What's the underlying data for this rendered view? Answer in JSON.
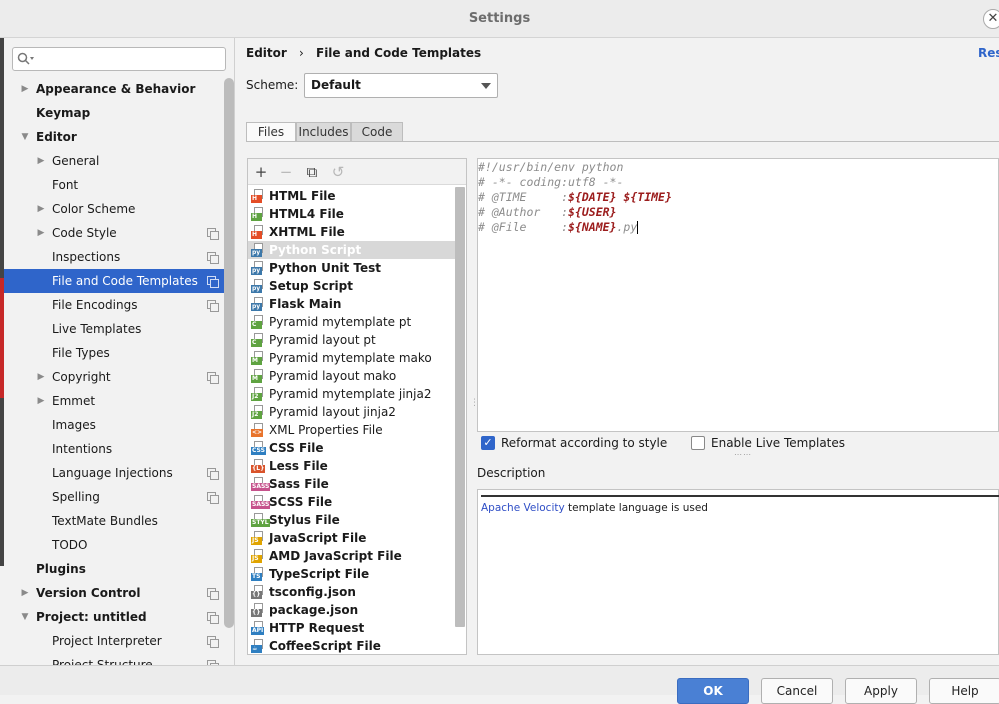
{
  "window": {
    "title": "Settings"
  },
  "search": {
    "placeholder": ""
  },
  "sidebar": {
    "items": [
      {
        "label": "Appearance & Behavior",
        "level": 0,
        "bold": true,
        "arrow": "collapsed",
        "copy": false
      },
      {
        "label": "Keymap",
        "level": 0,
        "bold": true,
        "arrow": "none",
        "copy": false
      },
      {
        "label": "Editor",
        "level": 0,
        "bold": true,
        "arrow": "expanded",
        "copy": false
      },
      {
        "label": "General",
        "level": 1,
        "bold": false,
        "arrow": "collapsed",
        "copy": false
      },
      {
        "label": "Font",
        "level": 1,
        "bold": false,
        "arrow": "none",
        "copy": false
      },
      {
        "label": "Color Scheme",
        "level": 1,
        "bold": false,
        "arrow": "collapsed",
        "copy": false
      },
      {
        "label": "Code Style",
        "level": 1,
        "bold": false,
        "arrow": "collapsed",
        "copy": true
      },
      {
        "label": "Inspections",
        "level": 1,
        "bold": false,
        "arrow": "none",
        "copy": true
      },
      {
        "label": "File and Code Templates",
        "level": 1,
        "bold": false,
        "arrow": "none",
        "copy": true,
        "selected": true
      },
      {
        "label": "File Encodings",
        "level": 1,
        "bold": false,
        "arrow": "none",
        "copy": true
      },
      {
        "label": "Live Templates",
        "level": 1,
        "bold": false,
        "arrow": "none",
        "copy": false
      },
      {
        "label": "File Types",
        "level": 1,
        "bold": false,
        "arrow": "none",
        "copy": false
      },
      {
        "label": "Copyright",
        "level": 1,
        "bold": false,
        "arrow": "collapsed",
        "copy": true
      },
      {
        "label": "Emmet",
        "level": 1,
        "bold": false,
        "arrow": "collapsed",
        "copy": false
      },
      {
        "label": "Images",
        "level": 1,
        "bold": false,
        "arrow": "none",
        "copy": false
      },
      {
        "label": "Intentions",
        "level": 1,
        "bold": false,
        "arrow": "none",
        "copy": false
      },
      {
        "label": "Language Injections",
        "level": 1,
        "bold": false,
        "arrow": "none",
        "copy": true
      },
      {
        "label": "Spelling",
        "level": 1,
        "bold": false,
        "arrow": "none",
        "copy": true
      },
      {
        "label": "TextMate Bundles",
        "level": 1,
        "bold": false,
        "arrow": "none",
        "copy": false
      },
      {
        "label": "TODO",
        "level": 1,
        "bold": false,
        "arrow": "none",
        "copy": false
      },
      {
        "label": "Plugins",
        "level": 0,
        "bold": true,
        "arrow": "none",
        "copy": false
      },
      {
        "label": "Version Control",
        "level": 0,
        "bold": true,
        "arrow": "collapsed",
        "copy": true
      },
      {
        "label": "Project: untitled",
        "level": 0,
        "bold": true,
        "arrow": "expanded",
        "copy": true
      },
      {
        "label": "Project Interpreter",
        "level": 1,
        "bold": false,
        "arrow": "none",
        "copy": true
      },
      {
        "label": "Project Structure",
        "level": 1,
        "bold": false,
        "arrow": "none",
        "copy": true
      }
    ]
  },
  "breadcrumb": {
    "root": "Editor",
    "separator": "›",
    "current": "File and Code Templates"
  },
  "reset_label": "Reset",
  "scheme": {
    "label": "Scheme:",
    "value": "Default"
  },
  "tabs": [
    {
      "label": "Files",
      "active": true
    },
    {
      "label": "Includes",
      "active": false
    },
    {
      "label": "Code",
      "active": false
    }
  ],
  "toolbar": {
    "add": "+",
    "remove": "−",
    "copy": "⧉",
    "reset": "↺"
  },
  "templates": [
    {
      "label": "HTML File",
      "bold": true,
      "badge": "H",
      "color": "#e44d26"
    },
    {
      "label": "HTML4 File",
      "bold": true,
      "badge": "H",
      "color": "#5fa341"
    },
    {
      "label": "XHTML File",
      "bold": true,
      "badge": "H",
      "color": "#e44d26"
    },
    {
      "label": "Python Script",
      "bold": true,
      "badge": "py",
      "color": "#3c78aa",
      "selected": true
    },
    {
      "label": "Python Unit Test",
      "bold": true,
      "badge": "py",
      "color": "#3c78aa"
    },
    {
      "label": "Setup Script",
      "bold": true,
      "badge": "py",
      "color": "#3c78aa"
    },
    {
      "label": "Flask Main",
      "bold": true,
      "badge": "py",
      "color": "#3c78aa"
    },
    {
      "label": "Pyramid mytemplate pt",
      "bold": false,
      "badge": "C",
      "color": "#5fa341"
    },
    {
      "label": "Pyramid layout pt",
      "bold": false,
      "badge": "C",
      "color": "#5fa341"
    },
    {
      "label": "Pyramid mytemplate mako",
      "bold": false,
      "badge": "M",
      "color": "#5fa341"
    },
    {
      "label": "Pyramid layout mako",
      "bold": false,
      "badge": "M",
      "color": "#5fa341"
    },
    {
      "label": "Pyramid mytemplate jinja2",
      "bold": false,
      "badge": "J2",
      "color": "#5fa341"
    },
    {
      "label": "Pyramid layout jinja2",
      "bold": false,
      "badge": "J2",
      "color": "#5fa341"
    },
    {
      "label": "XML Properties File",
      "bold": false,
      "badge": "<>",
      "color": "#e8742c"
    },
    {
      "label": "CSS File",
      "bold": true,
      "badge": "CSS",
      "color": "#2f7fc1"
    },
    {
      "label": "Less File",
      "bold": true,
      "badge": "{L}",
      "color": "#d9542b"
    },
    {
      "label": "Sass File",
      "bold": true,
      "badge": "SASS",
      "color": "#c6538c"
    },
    {
      "label": "SCSS File",
      "bold": true,
      "badge": "SASS",
      "color": "#c6538c"
    },
    {
      "label": "Stylus File",
      "bold": true,
      "badge": "STYL",
      "color": "#5fa341"
    },
    {
      "label": "JavaScript File",
      "bold": true,
      "badge": "JS",
      "color": "#e0a400"
    },
    {
      "label": "AMD JavaScript File",
      "bold": true,
      "badge": "JS",
      "color": "#e0a400"
    },
    {
      "label": "TypeScript File",
      "bold": true,
      "badge": "TS",
      "color": "#2f7fc1"
    },
    {
      "label": "tsconfig.json",
      "bold": true,
      "badge": "{}",
      "color": "#777777"
    },
    {
      "label": "package.json",
      "bold": true,
      "badge": "{}",
      "color": "#777777"
    },
    {
      "label": "HTTP Request",
      "bold": true,
      "badge": "API",
      "color": "#2f7fc1"
    },
    {
      "label": "CoffeeScript File",
      "bold": true,
      "badge": "☕",
      "color": "#2f7fc1"
    }
  ],
  "editor": {
    "lines": [
      [
        {
          "t": "#!/usr/bin/env python",
          "c": "cmt"
        }
      ],
      [
        {
          "t": "# -*- coding:utf8 -*-",
          "c": "cmt"
        }
      ],
      [
        {
          "t": "# @TIME     :",
          "c": "cmt"
        },
        {
          "t": "${DATE}",
          "c": "var"
        },
        {
          "t": " ",
          "c": "cmt"
        },
        {
          "t": "${TIME}",
          "c": "var"
        }
      ],
      [
        {
          "t": "# @Author   :",
          "c": "cmt"
        },
        {
          "t": "${USER}",
          "c": "var"
        }
      ],
      [
        {
          "t": "# @File     :",
          "c": "cmt"
        },
        {
          "t": "${NAME}",
          "c": "var"
        },
        {
          "t": ".py",
          "c": "cmt"
        }
      ]
    ]
  },
  "options": {
    "reformat": {
      "label": "Reformat according to style",
      "checked": true
    },
    "live": {
      "label": "Enable Live Templates",
      "checked": false
    }
  },
  "description": {
    "label": "Description",
    "link": "Apache Velocity",
    "text": " template language is used"
  },
  "buttons": {
    "ok": "OK",
    "cancel": "Cancel",
    "apply": "Apply",
    "help": "Help"
  }
}
